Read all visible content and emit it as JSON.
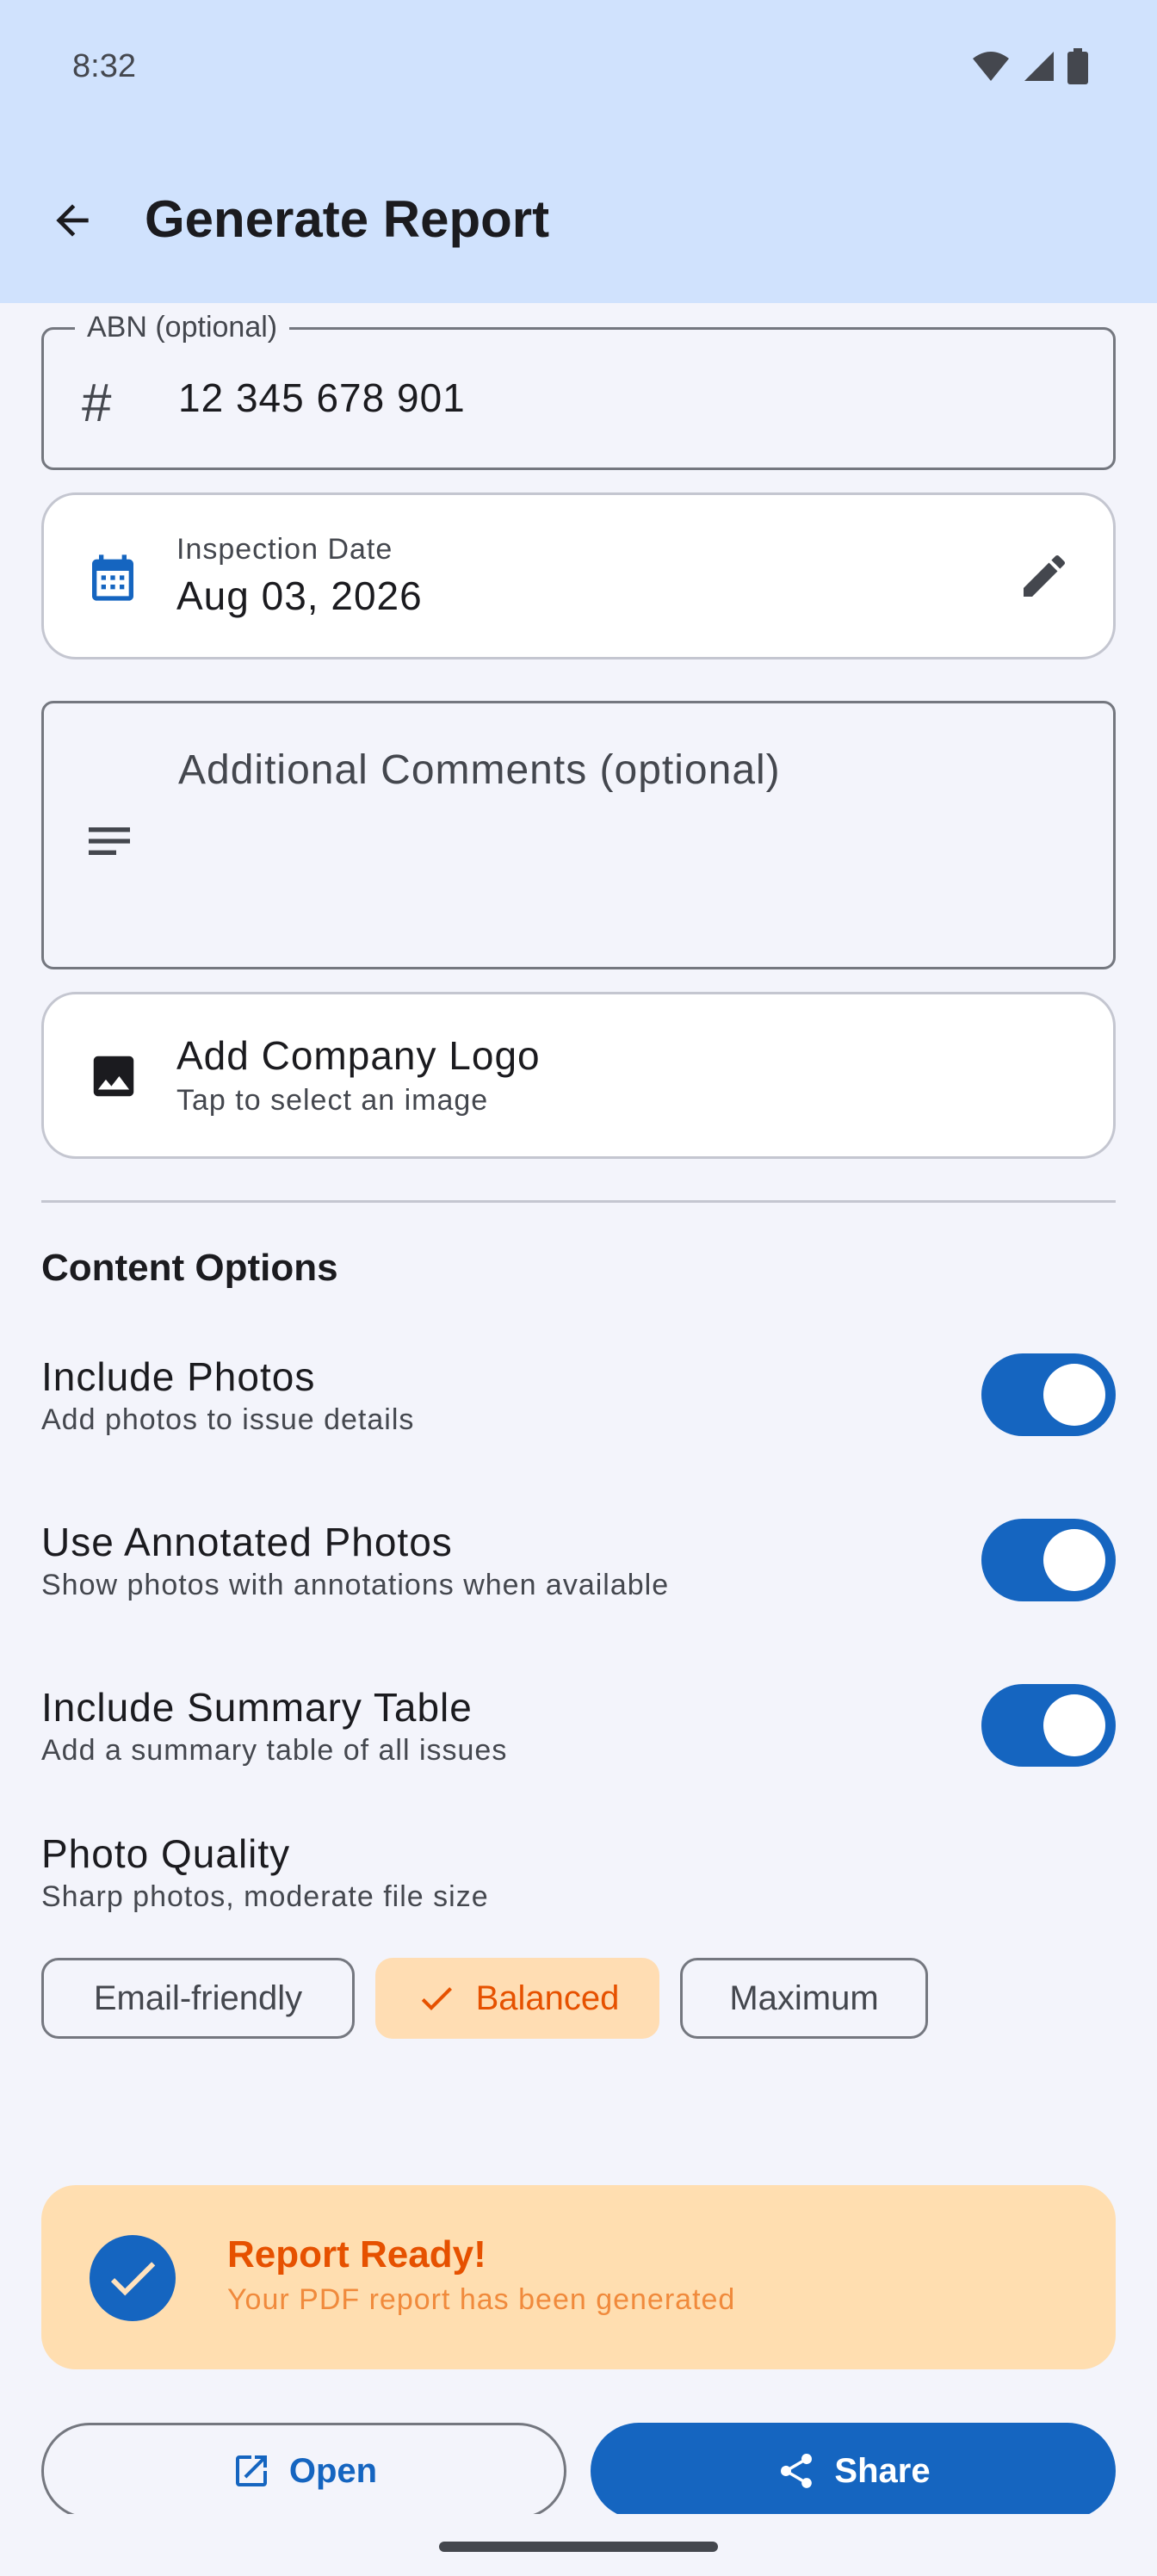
{
  "status_bar": {
    "time": "8:32"
  },
  "app_bar": {
    "title": "Generate Report",
    "back_icon": "arrow-back-icon"
  },
  "abn_field": {
    "label": "ABN (optional)",
    "value": "12 345 678 901",
    "icon": "hash-icon"
  },
  "inspection_date": {
    "label": "Inspection Date",
    "value": "Aug 03, 2026",
    "icon": "calendar-icon",
    "action_icon": "edit-icon"
  },
  "comments_field": {
    "placeholder": "Additional Comments (optional)",
    "icon": "notes-icon"
  },
  "company_logo": {
    "title": "Add Company Logo",
    "subtitle": "Tap to select an image",
    "icon": "image-icon"
  },
  "content_options": {
    "section_title": "Content Options",
    "options": [
      {
        "title": "Include Photos",
        "subtitle": "Add photos to issue details",
        "enabled": true
      },
      {
        "title": "Use Annotated Photos",
        "subtitle": "Show photos with annotations when available",
        "enabled": true
      },
      {
        "title": "Include Summary Table",
        "subtitle": "Add a summary table of all issues",
        "enabled": true
      }
    ]
  },
  "photo_quality": {
    "title": "Photo Quality",
    "subtitle": "Sharp photos, moderate file size",
    "chips": [
      {
        "label": "Email-friendly",
        "selected": false
      },
      {
        "label": "Balanced",
        "selected": true
      },
      {
        "label": "Maximum",
        "selected": false
      }
    ]
  },
  "report_status": {
    "title": "Report Ready!",
    "subtitle": "Your PDF report has been generated",
    "icon": "check-circle-icon"
  },
  "actions": {
    "open_label": "Open",
    "share_label": "Share"
  },
  "colors": {
    "primary": "#1565C0",
    "app_bar": "#D0E2FD",
    "background": "#F3F4FB",
    "accent_orange": "#E65100",
    "banner_bg": "#FFDEB0",
    "chip_selected_bg": "#FFDDB3"
  }
}
